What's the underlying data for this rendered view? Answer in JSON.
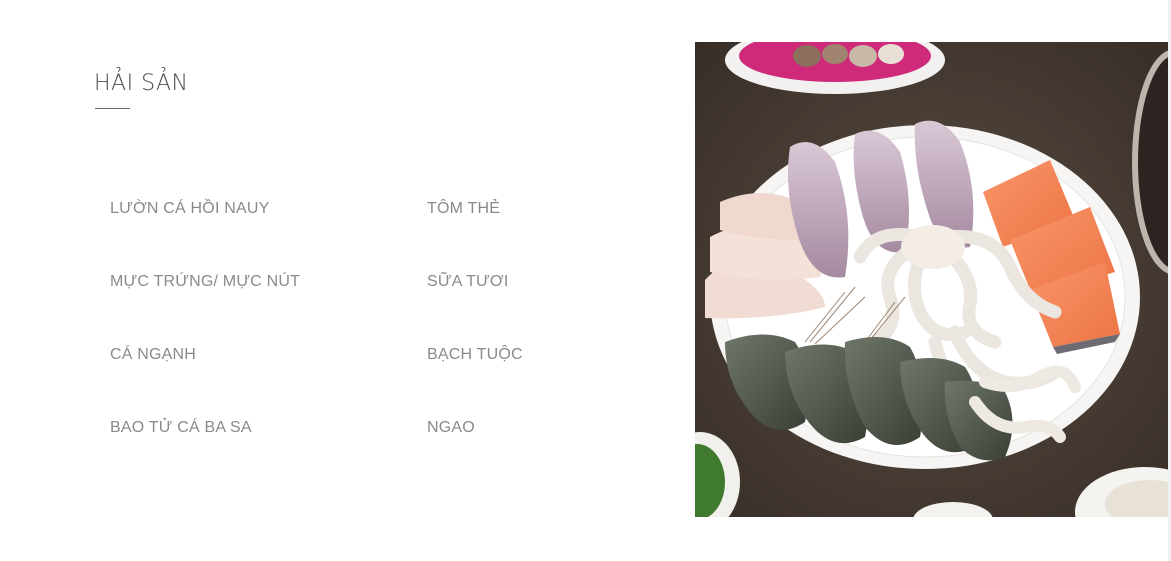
{
  "section": {
    "title": "HẢI SẢN"
  },
  "menu": {
    "items": [
      "LƯỜN CÁ HỒI NAUY",
      "TÔM THẺ",
      "MỰC TRỨNG/ MỰC NÚT",
      "SỮA TƯƠI",
      "CÁ NGẠNH",
      "BẠCH TUỘC",
      "BAO TỬ CÁ BA SA",
      "NGAO"
    ]
  },
  "photo": {
    "icon": "seafood-platter-photo"
  },
  "colors": {
    "title": "#4a4a4a",
    "item_text": "#8a8a8a",
    "photo_bg": "#4a3f37"
  }
}
